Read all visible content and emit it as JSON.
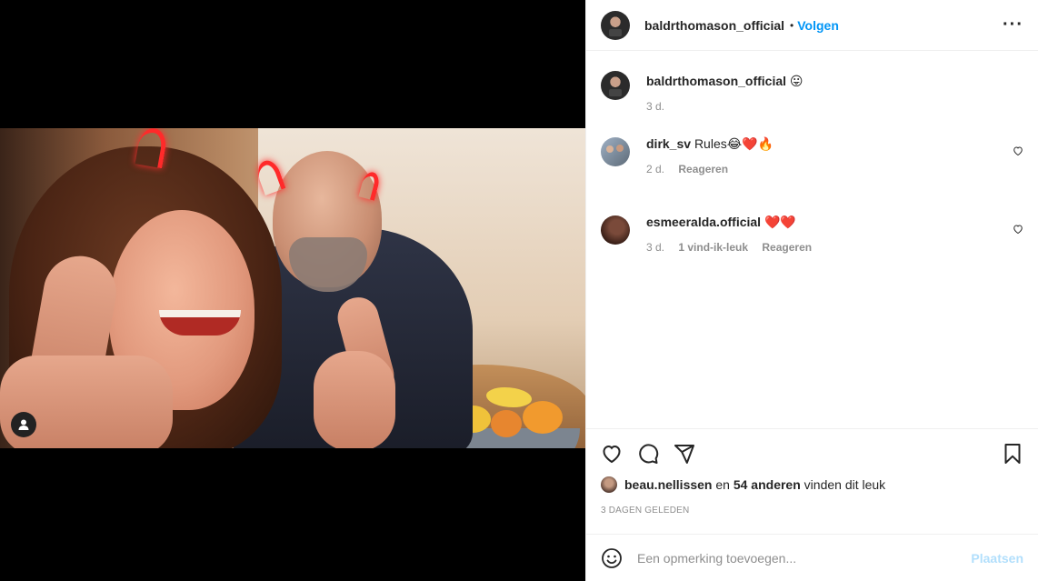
{
  "post": {
    "owner": "baldrthomason_official",
    "follow_label": "Volgen",
    "separator": "•",
    "more_label": "···"
  },
  "caption": {
    "username": "baldrthomason_official",
    "text": "😛",
    "age": "3 d."
  },
  "comments": [
    {
      "username": "dirk_sv",
      "text": "Rules😂❤️🔥",
      "age": "2 d.",
      "likes": "",
      "reply_label": "Reageren"
    },
    {
      "username": "esmeeralda.official",
      "text": "❤️❤️",
      "age": "3 d.",
      "likes": "1 vind-ik-leuk",
      "reply_label": "Reageren"
    }
  ],
  "likes": {
    "user": "beau.nellissen",
    "connector": "en",
    "others": "54 anderen",
    "suffix": "vinden dit leuk"
  },
  "posted_ago": "3 DAGEN GELEDEN",
  "add_comment": {
    "placeholder": "Een opmerking toevoegen...",
    "post_label": "Plaatsen"
  },
  "icons": [
    "user-tag-icon",
    "heart-icon",
    "comment-icon",
    "share-icon",
    "bookmark-icon",
    "emoji-icon",
    "more-icon"
  ],
  "colors": {
    "link_blue": "#0095f6",
    "post_disabled": "#b2dffc",
    "muted": "#8e8e8e"
  }
}
